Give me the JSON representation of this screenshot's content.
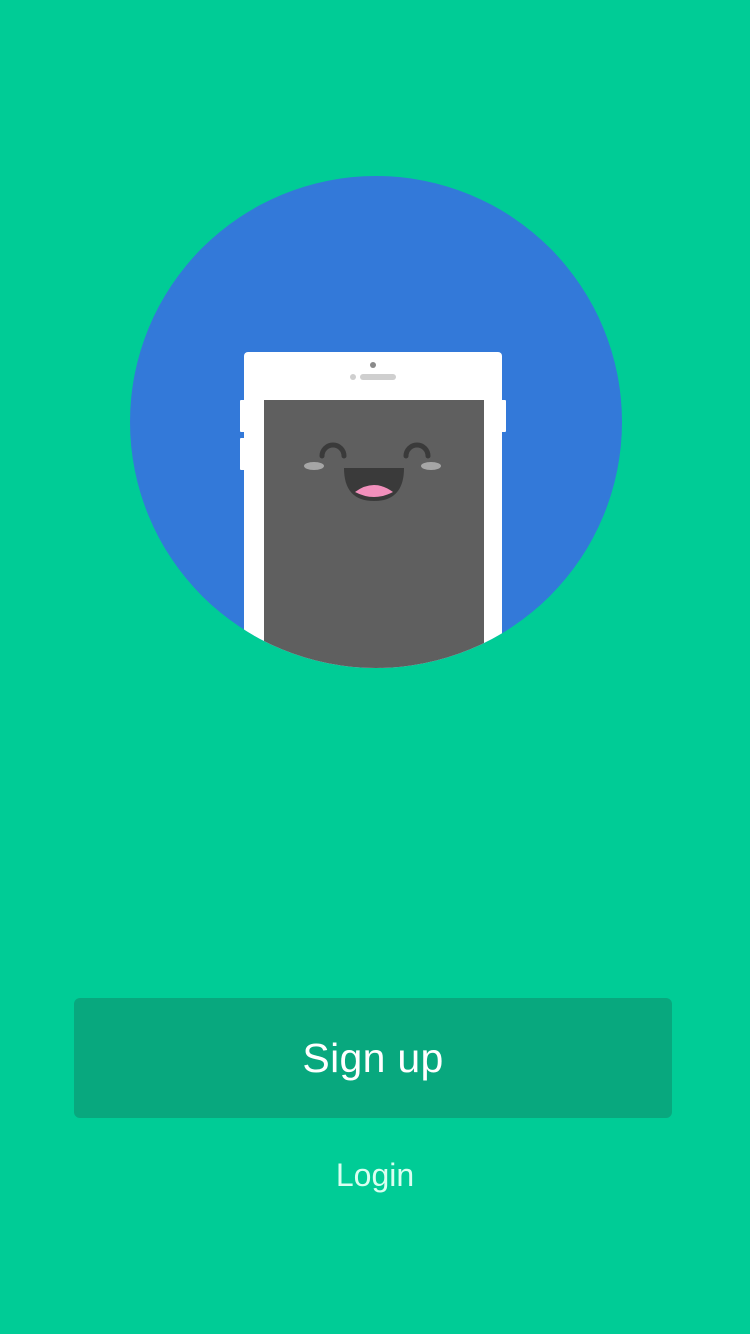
{
  "onboarding": {
    "illustration": {
      "icon": "smiling-phone-illustration",
      "circle_color": "#3379D9",
      "phone_body_color": "#FFFFFF",
      "screen_color": "#5F5F5F"
    },
    "signup_label": "Sign up",
    "login_label": "Login"
  },
  "colors": {
    "background": "#00CC96",
    "signup_button_bg": "#08A87E",
    "signup_text": "#FFFFFF",
    "login_text": "#D9FFF1"
  }
}
